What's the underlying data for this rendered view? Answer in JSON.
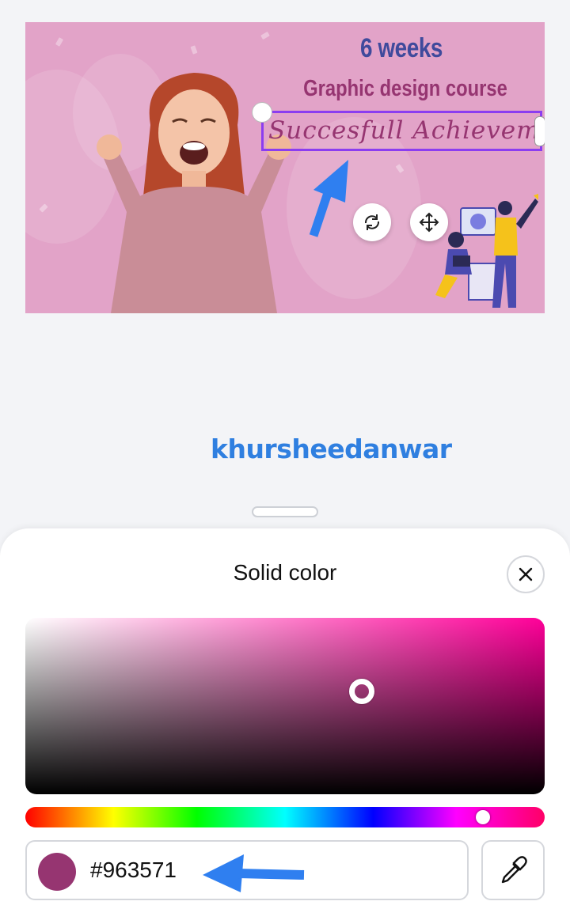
{
  "canvas": {
    "headline": "6 weeks",
    "subheadline": "Graphic design course",
    "selected_text": "Succesfull Achievement",
    "background_color": "#e2a3c8",
    "headline_color": "#3f4a9c",
    "text_color": "#963571",
    "selection_color": "#8b3df0",
    "annotation_arrow_color": "#2f7ff0",
    "rotate_icon": "rotate-icon",
    "move_icon": "move-icon"
  },
  "watermark": "khursheedanwar",
  "color_panel": {
    "title": "Solid color",
    "close_icon": "close-icon",
    "hex_value": "#963571",
    "swatch_color": "#963571",
    "eyedropper_icon": "eyedropper-icon",
    "picker_base_hue": "#ff0099"
  }
}
